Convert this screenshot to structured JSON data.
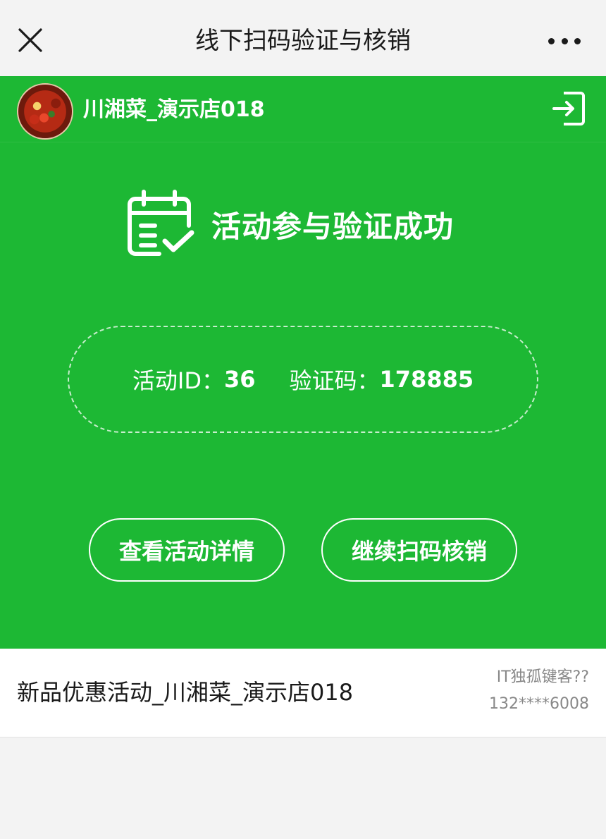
{
  "navbar": {
    "title": "线下扫码验证与核销"
  },
  "store": {
    "name": "川湘菜_演示店018"
  },
  "result": {
    "message": "活动参与验证成功"
  },
  "verification": {
    "activity_id_label": "活动ID：",
    "activity_id": "36",
    "code_label": "验证码：",
    "code": "178885"
  },
  "buttons": {
    "view_detail": "查看活动详情",
    "continue_scan": "继续扫码核销"
  },
  "activity_card": {
    "title": "新品优惠活动_川湘菜_演示店018",
    "user_name": "IT独孤键客??",
    "phone": "132****6008"
  },
  "colors": {
    "primary_green": "#1db834",
    "background": "#f3f3f3"
  },
  "icons": [
    "close-icon",
    "more-icon",
    "logout-icon",
    "calendar-check-icon"
  ]
}
